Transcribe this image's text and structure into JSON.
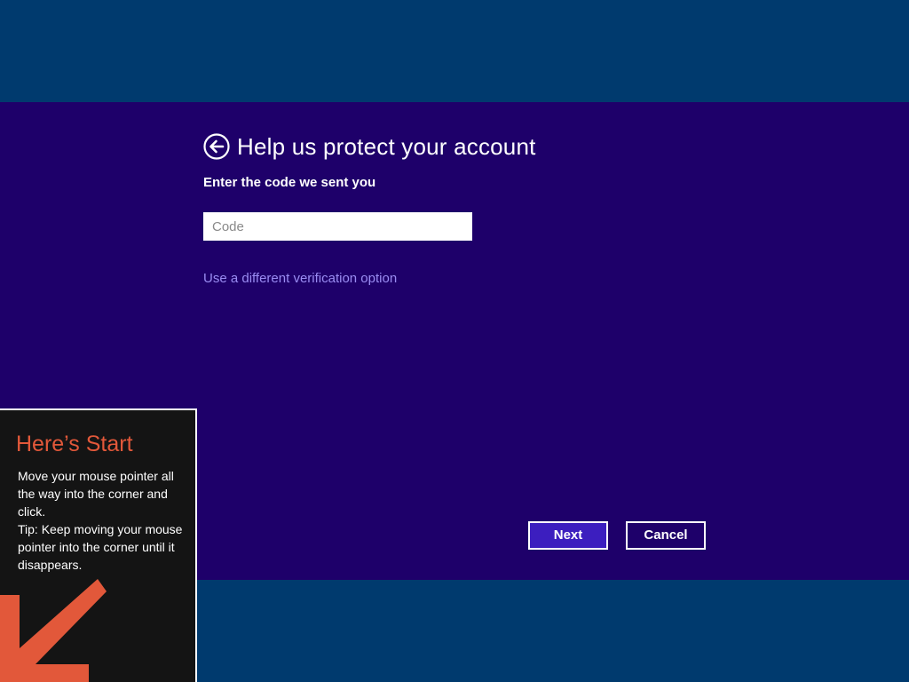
{
  "dialog": {
    "title": "Help us protect your account",
    "subtitle": "Enter the code we sent you",
    "code_input": {
      "placeholder": "Code",
      "value": ""
    },
    "alt_link": "Use a different verification option",
    "buttons": {
      "next": "Next",
      "cancel": "Cancel"
    }
  },
  "start_tip": {
    "title": "Here’s Start",
    "line1": "Move your mouse pointer all the way into the corner and click.",
    "line2": "Tip: Keep moving your mouse pointer into the corner until it disappears."
  },
  "colors": {
    "desktop_blue": "#003a6e",
    "dialog_purple": "#1e006a",
    "next_button": "#3c1ebf",
    "link": "#9a8cf2",
    "tip_accent": "#e2583a"
  },
  "icons": [
    "back-arrow-icon",
    "start-corner-arrow-icon"
  ]
}
